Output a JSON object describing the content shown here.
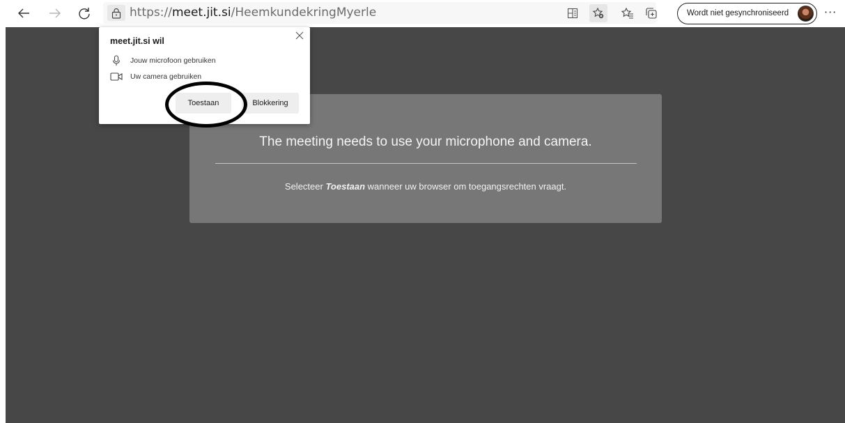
{
  "browser": {
    "url_prefix": "https://",
    "url_host": "meet.jit.si",
    "url_path": "/HeemkundekringMyerle",
    "sync_label": "Wordt niet gesynchroniseerd",
    "more_label": "···",
    "icons": {
      "back": "back-arrow-icon",
      "forward": "forward-arrow-icon",
      "refresh": "refresh-icon",
      "lock": "lock-icon",
      "reader": "reader-view-icon",
      "add_favorite": "add-favorite-icon",
      "favorites": "favorites-icon",
      "collections": "collections-icon"
    }
  },
  "permission_popup": {
    "title": "meet.jit.si wil",
    "mic_label": "Jouw microfoon gebruiken",
    "camera_label": "Uw camera gebruiken",
    "allow_label": "Toestaan",
    "block_label": "Blokkering"
  },
  "dialog": {
    "title": "The meeting needs to use your microphone and camera.",
    "sub_prefix": "Selecteer ",
    "sub_emphasis": "Toestaan",
    "sub_suffix": " wanneer uw browser om toegangsrechten vraagt."
  },
  "colors": {
    "page_background": "#474747",
    "dialog_background": "#777777",
    "annotation": "#000000"
  }
}
